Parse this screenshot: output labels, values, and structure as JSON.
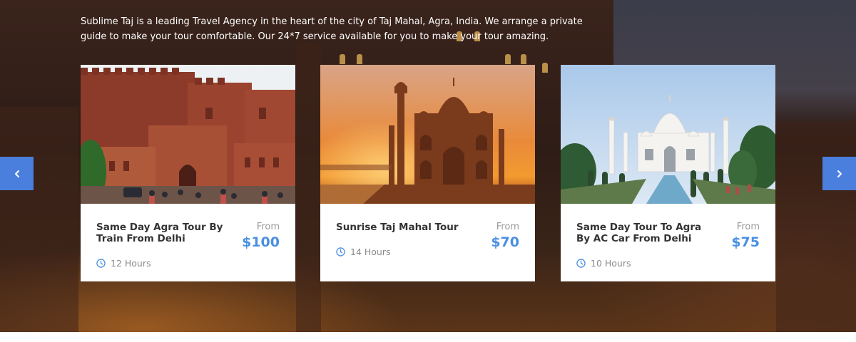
{
  "intro": {
    "text": "Sublime Taj is a leading Travel Agency in the heart of the city of Taj Mahal, Agra, India. We arrange a private guide to make your tour comfortable. Our 24*7 service available for you to make your tour amazing."
  },
  "slider": {
    "prev_icon": "chevron-left-icon",
    "next_icon": "chevron-right-icon"
  },
  "tours": [
    {
      "title": "Same Day Agra Tour By Train From Delhi",
      "from_label": "From",
      "price": "$100",
      "duration": "12 Hours",
      "photo": "agra-fort-photo"
    },
    {
      "title": "Sunrise Taj Mahal Tour",
      "from_label": "From",
      "price": "$70",
      "duration": "14 Hours",
      "photo": "taj-mahal-sunrise-photo"
    },
    {
      "title": "Same Day Tour To Agra By AC Car From Delhi",
      "from_label": "From",
      "price": "$75",
      "duration": "10 Hours",
      "photo": "taj-mahal-day-photo"
    }
  ],
  "colors": {
    "accent": "#4a90e2",
    "nav_button": "#4a7fde"
  }
}
